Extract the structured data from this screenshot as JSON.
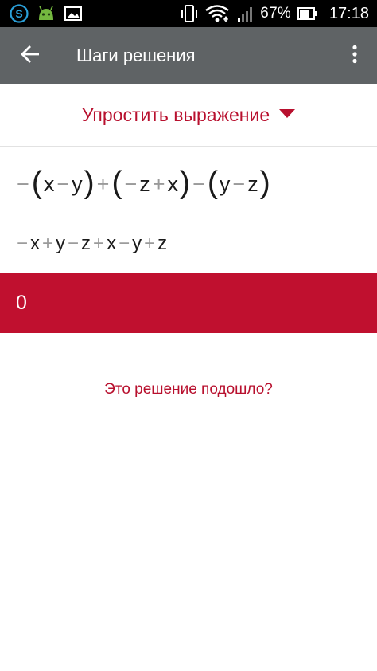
{
  "status_bar": {
    "icons_left": [
      "skype-icon",
      "android-head-icon",
      "image-icon"
    ],
    "icons_right": [
      "vibrate-icon",
      "wifi-icon",
      "signal-icon",
      "battery-icon"
    ],
    "battery": "67%",
    "time": "17:18"
  },
  "app_bar": {
    "title": "Шаги решения",
    "background": "#5f6365"
  },
  "selector": {
    "label": "Упростить выражение",
    "accent": "#b8102e"
  },
  "steps": {
    "step1": {
      "tokens": [
        "−",
        "(",
        "x",
        "−",
        "y",
        ")",
        "+",
        "(",
        "−",
        "z",
        "+",
        "x",
        ")",
        "−",
        "(",
        "y",
        "−",
        "z",
        ")"
      ]
    },
    "step2": {
      "tokens": [
        "−",
        "x",
        "+",
        "y",
        "−",
        "z",
        "+",
        "x",
        "−",
        "y",
        "+",
        "z"
      ]
    }
  },
  "result": {
    "value": "0",
    "background": "#c0102f"
  },
  "feedback": {
    "text": "Это решение подошло?"
  }
}
